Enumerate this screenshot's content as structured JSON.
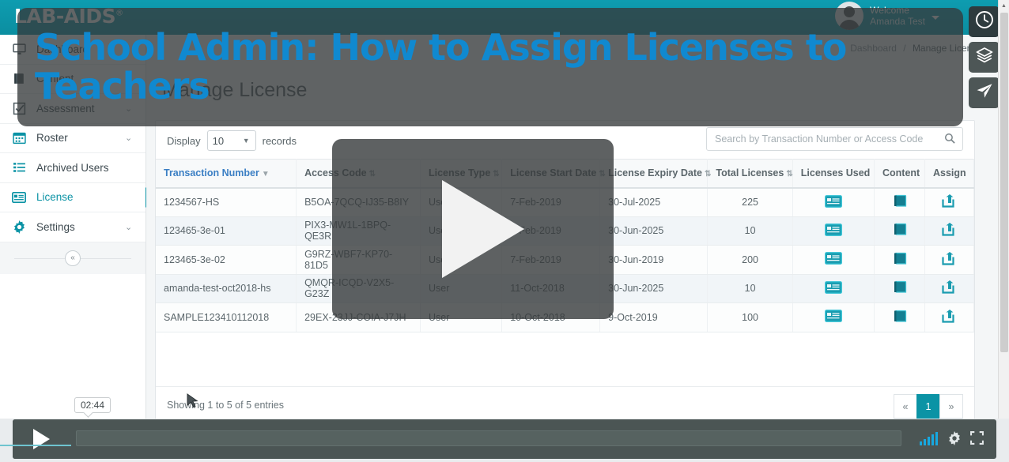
{
  "app": {
    "logo": "LAB-AIDS",
    "logo_tm": "®",
    "welcome_line1": "Welcome",
    "welcome_line2": "Amanda Test"
  },
  "sidebar": {
    "items": [
      {
        "label": "Dashboard",
        "icon": "monitor-icon",
        "chevron": "",
        "active": false
      },
      {
        "label": "Content",
        "icon": "book-icon",
        "chevron": "⌄",
        "active": false
      },
      {
        "label": "Assessment",
        "icon": "checkbox-icon",
        "chevron": "⌄",
        "active": false
      },
      {
        "label": "Roster",
        "icon": "calendar-icon",
        "chevron": "⌄",
        "active": false
      },
      {
        "label": "Archived Users",
        "icon": "list-icon",
        "chevron": "",
        "active": false
      },
      {
        "label": "License",
        "icon": "license-card-icon",
        "chevron": "",
        "active": true
      },
      {
        "label": "Settings",
        "icon": "gear-icon",
        "chevron": "⌄",
        "active": false
      }
    ],
    "collapse_label": "«"
  },
  "breadcrumb": {
    "home": "Dashboard",
    "separator": "/",
    "current": "Manage License"
  },
  "page": {
    "title": "Manage License"
  },
  "toolbar": {
    "display_label": "Display",
    "records_label": "records",
    "page_size": "10",
    "select_caret": "▼",
    "search_placeholder": "Search by Transaction Number or Access Code",
    "search_value": "",
    "search_icon": "🔍"
  },
  "table": {
    "columns": [
      {
        "label": "Transaction Number",
        "sort": "desc",
        "align": "left"
      },
      {
        "label": "Access Code",
        "sort": "both",
        "align": "left"
      },
      {
        "label": "License Type",
        "sort": "both",
        "align": "left"
      },
      {
        "label": "License Start Date",
        "sort": "both",
        "align": "left"
      },
      {
        "label": "License Expiry Date",
        "sort": "both",
        "align": "left"
      },
      {
        "label": "Total Licenses",
        "sort": "both",
        "align": "center"
      },
      {
        "label": "Licenses Used",
        "sort": "none",
        "align": "center"
      },
      {
        "label": "Content",
        "sort": "none",
        "align": "center"
      },
      {
        "label": "Assign",
        "sort": "none",
        "align": "center"
      }
    ],
    "sort_desc_glyph": "▼",
    "sort_both_glyph": "⇅",
    "rows": [
      {
        "transaction_number": "1234567-HS",
        "access_code": "B5OA-7QCQ-IJ35-B8IY",
        "license_type": "User",
        "license_start_date": "7-Feb-2019",
        "license_expiry_date": "30-Jul-2025",
        "total_licenses": "225"
      },
      {
        "transaction_number": "123465-3e-01",
        "access_code": "PIX3-MW1L-1BPQ-QE3R",
        "license_type": "User",
        "license_start_date": "7-Feb-2019",
        "license_expiry_date": "30-Jun-2025",
        "total_licenses": "10"
      },
      {
        "transaction_number": "123465-3e-02",
        "access_code": "G9RZ-WBF7-KP70-81D5",
        "license_type": "User",
        "license_start_date": "7-Feb-2019",
        "license_expiry_date": "30-Jun-2019",
        "total_licenses": "200"
      },
      {
        "transaction_number": "amanda-test-oct2018-hs",
        "access_code": "QMQR-ICQD-V2X5-G23Z",
        "license_type": "User",
        "license_start_date": "11-Oct-2018",
        "license_expiry_date": "30-Jun-2025",
        "total_licenses": "10"
      },
      {
        "transaction_number": "SAMPLE123410112018",
        "access_code": "29EX-23JJ-COIA-J7JH",
        "license_type": "User",
        "license_start_date": "10-Oct-2018",
        "license_expiry_date": "9-Oct-2019",
        "total_licenses": "100"
      }
    ]
  },
  "footer": {
    "showing": "Showing 1 to 5 of 5 entries",
    "prev": "«",
    "page": "1",
    "next": "»"
  },
  "rail": {
    "items": [
      {
        "icon": "clock-icon",
        "style": "dark"
      },
      {
        "icon": "layers-icon",
        "style": "gray"
      },
      {
        "icon": "paper-plane-icon",
        "style": "gray"
      }
    ]
  },
  "video": {
    "overlay_title": "School Admin: How to Assign Licenses to Teachers",
    "play_label": "play",
    "time_tooltip": "02:44",
    "progress_percent": 0,
    "volume_bars": 5,
    "gear_icon": "⚙",
    "fullscreen_icon": "⛶"
  },
  "colors": {
    "brand_teal": "#0b93a5",
    "overlay_title_blue": "#1089d0",
    "overlay_panel": "rgba(54,58,59,0.78)",
    "volume_blue": "#17a8e0"
  }
}
